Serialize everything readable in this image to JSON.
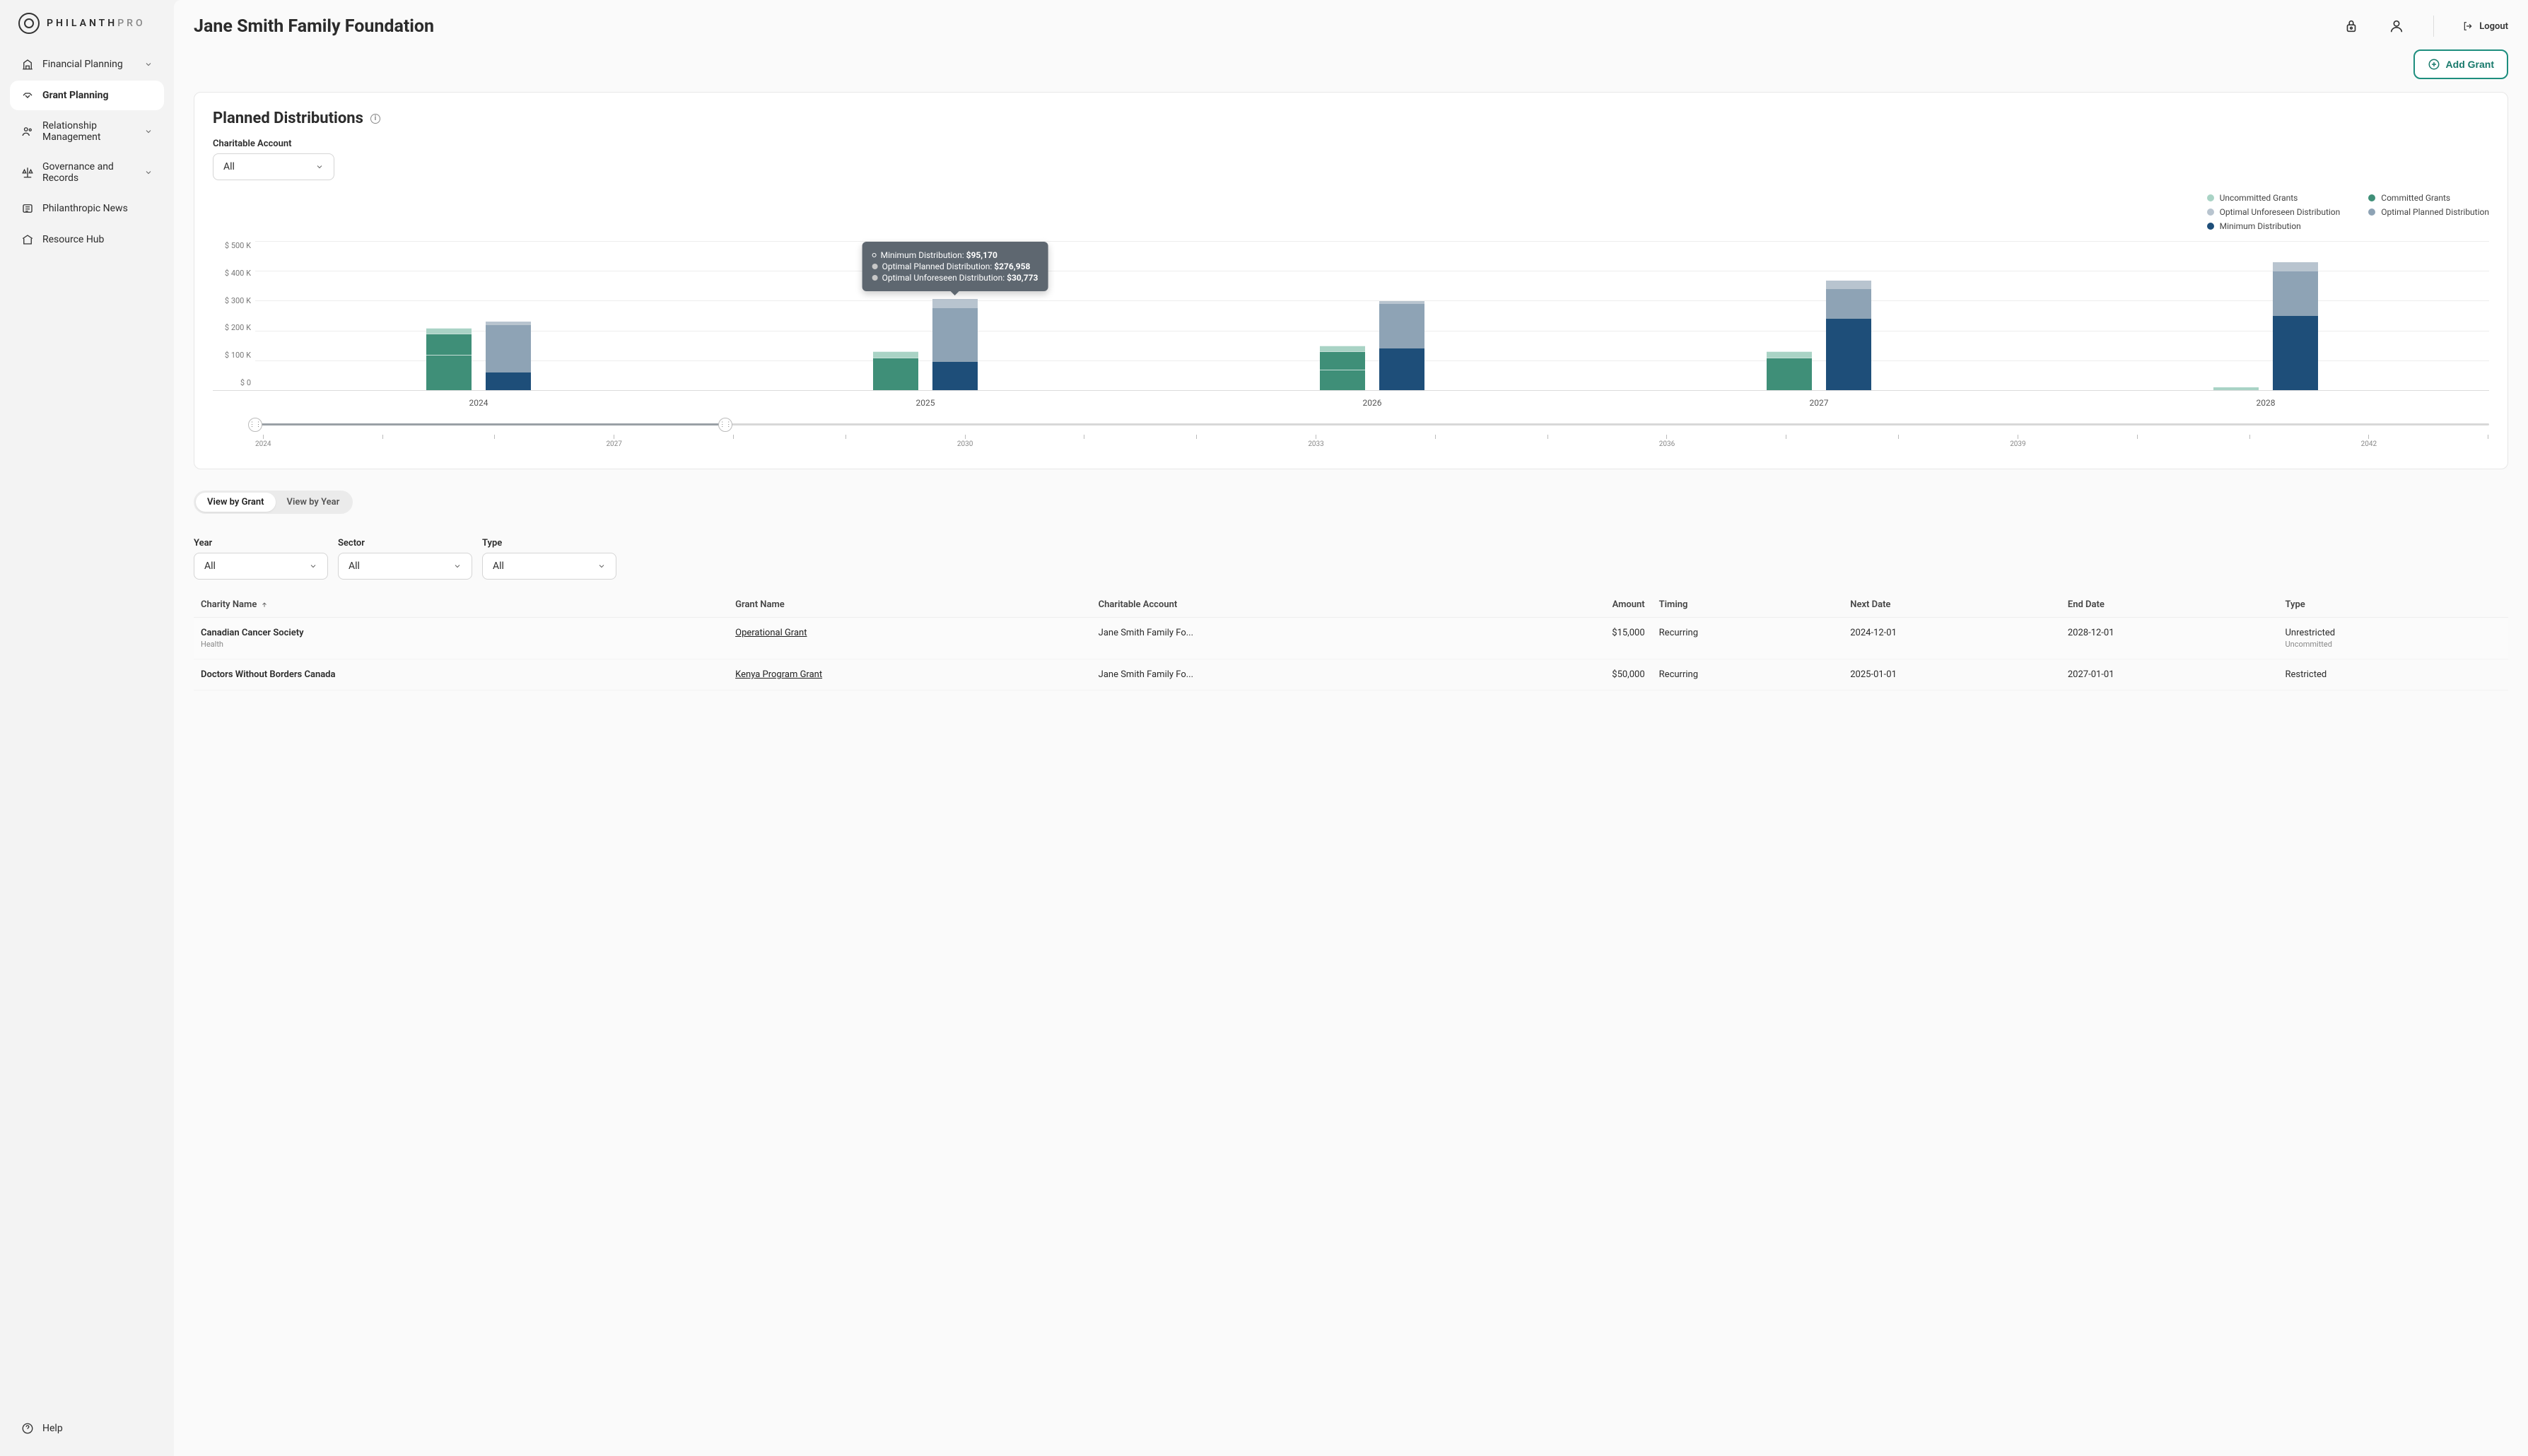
{
  "brand": {
    "name1": "PHILANTH",
    "name2": "PRO"
  },
  "nav": {
    "items": [
      {
        "label": "Financial Planning",
        "expandable": true
      },
      {
        "label": "Grant Planning",
        "expandable": false
      },
      {
        "label": "Relationship Management",
        "expandable": true
      },
      {
        "label": "Governance and Records",
        "expandable": true
      },
      {
        "label": "Philanthropic News",
        "expandable": false
      },
      {
        "label": "Resource Hub",
        "expandable": false
      }
    ],
    "help": "Help"
  },
  "header": {
    "title": "Jane Smith Family Foundation",
    "logout": "Logout",
    "add_grant": "Add Grant"
  },
  "distributions": {
    "title": "Planned Distributions",
    "filter_label": "Charitable Account",
    "filter_value": "All",
    "legend": {
      "uncommitted": "Uncommitted Grants",
      "committed": "Committed Grants",
      "opt_unforeseen": "Optimal Unforeseen Distribution",
      "opt_planned": "Optimal Planned Distribution",
      "minimum": "Minimum Distribution"
    },
    "colors": {
      "uncommitted": "#a9d3c5",
      "committed": "#3f8f78",
      "opt_unforeseen": "#b8c4cf",
      "opt_planned": "#8ea3b5",
      "minimum": "#1e4e79"
    },
    "tooltip": {
      "min_label": "Minimum Distribution:",
      "min_val": "$95,170",
      "opt_p_label": "Optimal Planned Distribution:",
      "opt_p_val": "$276,958",
      "opt_u_label": "Optimal Unforeseen Distribution:",
      "opt_u_val": "$30,773"
    }
  },
  "chart_data": {
    "type": "bar",
    "yticks": [
      "$ 500 K",
      "$ 400 K",
      "$ 300 K",
      "$ 200 K",
      "$ 100 K",
      "$ 0"
    ],
    "ymax": 500,
    "years": [
      "2024",
      "2025",
      "2026",
      "2027",
      "2028"
    ],
    "grants": {
      "2024": {
        "uncommitted": 20,
        "committed": [
          60,
          60,
          70
        ]
      },
      "2025": {
        "uncommitted": 20,
        "committed": [
          50,
          60
        ]
      },
      "2026": {
        "uncommitted": 20,
        "committed": [
          30,
          40,
          60
        ]
      },
      "2027": {
        "uncommitted": 20,
        "committed": [
          50,
          60
        ]
      },
      "2028": {
        "uncommitted": 10,
        "committed": []
      }
    },
    "distributions": {
      "2024": {
        "minimum": 60,
        "opt_planned": 160,
        "opt_unforeseen": 10
      },
      "2025": {
        "minimum": 95.17,
        "opt_planned": 181.79,
        "opt_unforeseen": 30.77
      },
      "2026": {
        "minimum": 140,
        "opt_planned": 150,
        "opt_unforeseen": 10
      },
      "2027": {
        "minimum": 240,
        "opt_planned": 100,
        "opt_unforeseen": 30
      },
      "2028": {
        "minimum": 250,
        "opt_planned": 150,
        "opt_unforeseen": 30
      }
    },
    "slider": {
      "min": 2024,
      "max": 2043,
      "sel_from": 2024,
      "sel_to": 2028,
      "ticks": [
        "2024",
        "2027",
        "2030",
        "2033",
        "2036",
        "2039",
        "2042"
      ]
    }
  },
  "view_toggle": {
    "by_grant": "View by Grant",
    "by_year": "View by Year"
  },
  "table_filters": {
    "year": {
      "label": "Year",
      "value": "All"
    },
    "sector": {
      "label": "Sector",
      "value": "All"
    },
    "type": {
      "label": "Type",
      "value": "All"
    }
  },
  "table": {
    "headers": {
      "charity": "Charity Name",
      "grant": "Grant Name",
      "account": "Charitable Account",
      "amount": "Amount",
      "timing": "Timing",
      "next": "Next Date",
      "end": "End Date",
      "type": "Type"
    },
    "rows": [
      {
        "charity": "Canadian Cancer Society",
        "sector": "Health",
        "grant": "Operational Grant",
        "account": "Jane Smith Family Fo...",
        "amount": "$15,000",
        "timing": "Recurring",
        "next": "2024-12-01",
        "end": "2028-12-01",
        "type": "Unrestricted",
        "type_sub": "Uncommitted"
      },
      {
        "charity": "Doctors Without Borders Canada",
        "sector": "",
        "grant": "Kenya Program Grant",
        "account": "Jane Smith Family Fo...",
        "amount": "$50,000",
        "timing": "Recurring",
        "next": "2025-01-01",
        "end": "2027-01-01",
        "type": "Restricted",
        "type_sub": ""
      }
    ]
  }
}
